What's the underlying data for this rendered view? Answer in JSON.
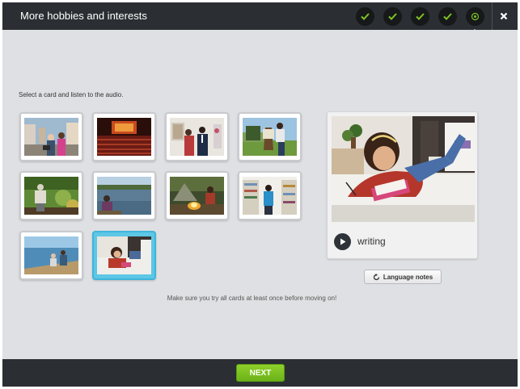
{
  "header": {
    "title": "More hobbies and interests",
    "steps": [
      {
        "state": "complete",
        "icon": "check-icon"
      },
      {
        "state": "complete",
        "icon": "check-icon"
      },
      {
        "state": "complete",
        "icon": "check-icon"
      },
      {
        "state": "complete",
        "icon": "check-icon"
      },
      {
        "state": "current",
        "icon": "target-icon"
      }
    ],
    "close_icon": "close-icon"
  },
  "instruction": "Select a card and listen to the audio.",
  "cards": [
    {
      "name": "card-family-photo",
      "selected": false
    },
    {
      "name": "card-theater",
      "selected": false
    },
    {
      "name": "card-conversation",
      "selected": false
    },
    {
      "name": "card-painting",
      "selected": false
    },
    {
      "name": "card-gardening",
      "selected": false
    },
    {
      "name": "card-lake",
      "selected": false
    },
    {
      "name": "card-campfire",
      "selected": false
    },
    {
      "name": "card-library",
      "selected": false
    },
    {
      "name": "card-fishing",
      "selected": false
    },
    {
      "name": "card-writing",
      "selected": true
    }
  ],
  "preview": {
    "word": "writing",
    "play_icon": "play-icon"
  },
  "language_notes_label": "Language notes",
  "note": "Make sure you try all cards at least once before moving on!",
  "footer": {
    "next_label": "NEXT"
  },
  "colors": {
    "header_bg": "#2b2f33",
    "accent_green": "#7ec224",
    "selected_card": "#5ec7e6",
    "page_bg": "#dfe0e3"
  }
}
